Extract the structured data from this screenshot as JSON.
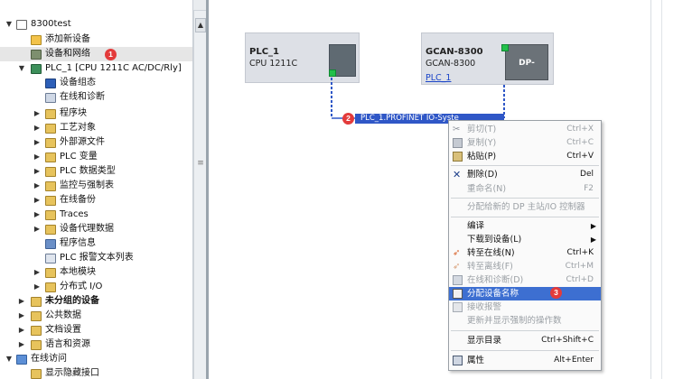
{
  "tree": {
    "project": "8300test",
    "items": [
      {
        "label": "添加新设备",
        "icon": "add-device-icon"
      },
      {
        "label": "设备和网络",
        "icon": "devices-networks-icon"
      },
      {
        "label": "PLC_1 [CPU 1211C AC/DC/Rly]",
        "icon": "plc-icon"
      },
      {
        "label": "设备组态",
        "icon": "device-config-icon"
      },
      {
        "label": "在线和诊断",
        "icon": "online-diagnostics-icon"
      },
      {
        "label": "程序块",
        "icon": "folder-icon"
      },
      {
        "label": "工艺对象",
        "icon": "folder-icon"
      },
      {
        "label": "外部源文件",
        "icon": "folder-icon"
      },
      {
        "label": "PLC 变量",
        "icon": "folder-icon"
      },
      {
        "label": "PLC 数据类型",
        "icon": "folder-icon"
      },
      {
        "label": "监控与强制表",
        "icon": "folder-icon"
      },
      {
        "label": "在线备份",
        "icon": "folder-icon"
      },
      {
        "label": "Traces",
        "icon": "folder-icon"
      },
      {
        "label": "设备代理数据",
        "icon": "folder-icon"
      },
      {
        "label": "程序信息",
        "icon": "program-info-icon"
      },
      {
        "label": "PLC 报警文本列表",
        "icon": "alarm-text-icon"
      },
      {
        "label": "本地模块",
        "icon": "folder-icon"
      },
      {
        "label": "分布式 I/O",
        "icon": "folder-icon"
      },
      {
        "label": "未分组的设备",
        "icon": "folder-icon"
      },
      {
        "label": "公共数据",
        "icon": "folder-icon"
      },
      {
        "label": "文档设置",
        "icon": "folder-icon"
      },
      {
        "label": "语言和资源",
        "icon": "folder-icon"
      },
      {
        "label": "在线访问",
        "icon": "online-access-icon"
      },
      {
        "label": "显示隐藏接口",
        "icon": "folder-icon"
      }
    ]
  },
  "network": {
    "plc": {
      "name": "PLC_1",
      "type": "CPU 1211C"
    },
    "gcan": {
      "name": "GCAN-8300",
      "type": "GCAN-8300",
      "link": "PLC_1",
      "module": "DP-NORM"
    },
    "profinet_label": "PLC_1.PROFINET IO-Syste"
  },
  "markers": {
    "m1": "1",
    "m2": "2",
    "m3": "3"
  },
  "context_menu": {
    "cut": {
      "label": "剪切(T)",
      "shortcut": "Ctrl+X"
    },
    "copy": {
      "label": "复制(Y)",
      "shortcut": "Ctrl+C"
    },
    "paste": {
      "label": "粘贴(P)",
      "shortcut": "Ctrl+V"
    },
    "delete": {
      "label": "删除(D)",
      "shortcut": "Del"
    },
    "rename": {
      "label": "重命名(N)",
      "shortcut": "F2"
    },
    "assign_dp": {
      "label": "分配给新的 DP 主站/IO 控制器"
    },
    "compile": {
      "label": "编译"
    },
    "download": {
      "label": "下载到设备(L)"
    },
    "go_online": {
      "label": "转至在线(N)",
      "shortcut": "Ctrl+K"
    },
    "go_offline": {
      "label": "转至离线(F)",
      "shortcut": "Ctrl+M"
    },
    "online_diag": {
      "label": "在线和诊断(D)",
      "shortcut": "Ctrl+D"
    },
    "assign_name": {
      "label": "分配设备名称"
    },
    "receive_alarms": {
      "label": "接收报警"
    },
    "update_forced": {
      "label": "更新并显示强制的操作数"
    },
    "show_catalog": {
      "label": "显示目录",
      "shortcut": "Ctrl+Shift+C"
    },
    "properties": {
      "label": "属性",
      "shortcut": "Alt+Enter"
    }
  },
  "colors": {
    "highlight": "#3d6fd1",
    "network": "#2f57c7",
    "marker": "#e33b3b",
    "port": "#22c04a"
  }
}
